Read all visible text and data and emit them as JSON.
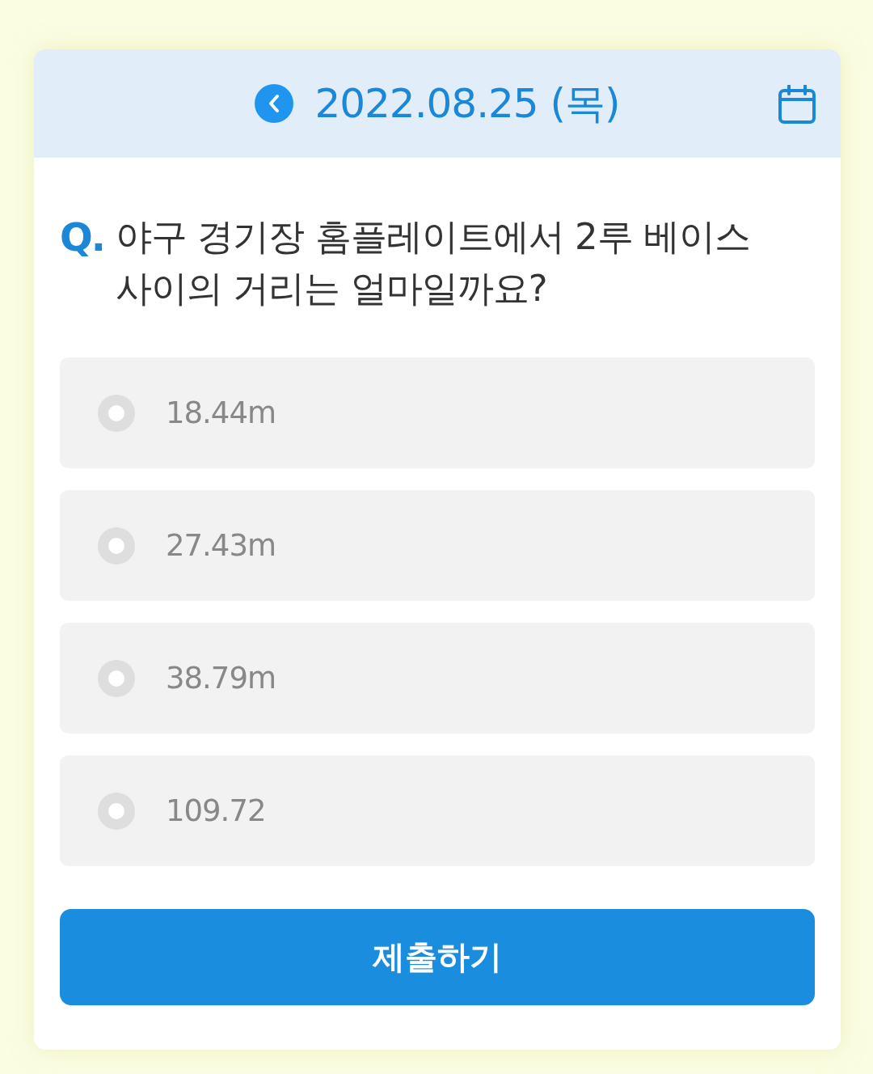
{
  "header": {
    "date": "2022.08.25 (목)"
  },
  "question": {
    "mark": "Q.",
    "text": "야구 경기장 홈플레이트에서 2루 베이스 사이의 거리는 얼마일까요?"
  },
  "options": [
    {
      "label": "18.44m",
      "selected": false
    },
    {
      "label": "27.43m",
      "selected": false
    },
    {
      "label": "38.79m",
      "selected": false
    },
    {
      "label": "109.72",
      "selected": false
    }
  ],
  "submit_button": {
    "label": "제출하기"
  }
}
